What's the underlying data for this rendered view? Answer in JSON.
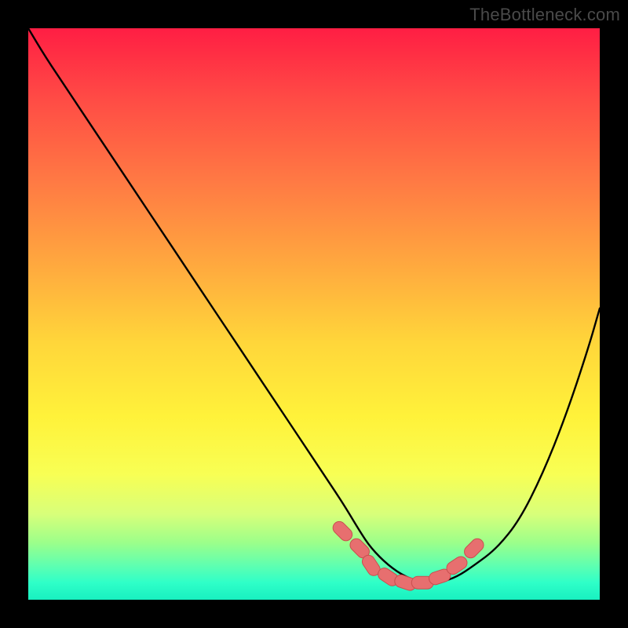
{
  "watermark": "TheBottleneck.com",
  "colors": {
    "frame": "#000000",
    "curve": "#000000",
    "marker_fill": "#e76f6f",
    "marker_stroke": "#c94f4f"
  },
  "chart_data": {
    "type": "line",
    "title": "",
    "xlabel": "",
    "ylabel": "",
    "xlim": [
      0,
      100
    ],
    "ylim": [
      0,
      100
    ],
    "grid": false,
    "series": [
      {
        "name": "bottleneck-curve",
        "x": [
          0,
          3,
          7,
          11,
          15,
          19,
          23,
          27,
          31,
          35,
          39,
          43,
          47,
          51,
          55,
          58,
          60,
          63,
          66,
          69,
          72,
          75,
          78,
          82,
          86,
          90,
          94,
          98,
          100
        ],
        "y": [
          100,
          95,
          89,
          83,
          77,
          71,
          65,
          59,
          53,
          47,
          41,
          35,
          29,
          23,
          17,
          12,
          9,
          6,
          4,
          3,
          3,
          4,
          6,
          9,
          14,
          22,
          32,
          44,
          51
        ]
      }
    ],
    "markers": {
      "name": "bottleneck-highlight",
      "x": [
        55,
        58,
        60,
        63,
        66,
        69,
        72,
        75,
        78
      ],
      "y": [
        12,
        9,
        6,
        4,
        3,
        3,
        4,
        6,
        9
      ]
    }
  }
}
